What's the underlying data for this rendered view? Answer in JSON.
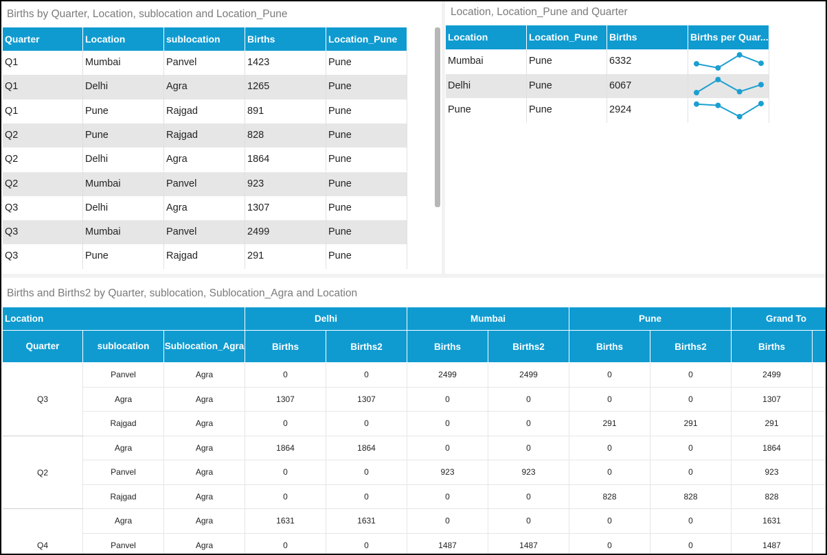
{
  "top_left": {
    "title": "Births by Quarter, Location, sublocation and Location_Pune",
    "headers": [
      "Quarter",
      "Location",
      "sublocation",
      "Births",
      "Location_Pune"
    ],
    "rows": [
      [
        "Q1",
        "Mumbai",
        "Panvel",
        "1423",
        "Pune"
      ],
      [
        "Q1",
        "Delhi",
        "Agra",
        "1265",
        "Pune"
      ],
      [
        "Q1",
        "Pune",
        "Rajgad",
        "891",
        "Pune"
      ],
      [
        "Q2",
        "Pune",
        "Rajgad",
        "828",
        "Pune"
      ],
      [
        "Q2",
        "Delhi",
        "Agra",
        "1864",
        "Pune"
      ],
      [
        "Q2",
        "Mumbai",
        "Panvel",
        "923",
        "Pune"
      ],
      [
        "Q3",
        "Delhi",
        "Agra",
        "1307",
        "Pune"
      ],
      [
        "Q3",
        "Mumbai",
        "Panvel",
        "2499",
        "Pune"
      ],
      [
        "Q3",
        "Pune",
        "Rajgad",
        "291",
        "Pune"
      ]
    ]
  },
  "top_right": {
    "title": "Location, Location_Pune and Quarter",
    "headers": [
      "Location",
      "Location_Pune",
      "Births",
      "Births per Quar..."
    ],
    "rows": [
      {
        "location": "Mumbai",
        "location_pune": "Pune",
        "births": "6332",
        "spark": [
          1423,
          923,
          2499,
          1487
        ]
      },
      {
        "location": "Delhi",
        "location_pune": "Pune",
        "births": "6067",
        "spark": [
          1265,
          1864,
          1307,
          1631
        ]
      },
      {
        "location": "Pune",
        "location_pune": "Pune",
        "births": "2924",
        "spark": [
          891,
          828,
          291,
          914
        ]
      }
    ],
    "spark_color": "#1a9fd1"
  },
  "bottom": {
    "title": "Births and Births2 by Quarter, sublocation, Sublocation_Agra and Location",
    "location_label": "Location",
    "groups": [
      "Delhi",
      "Mumbai",
      "Pune",
      "Grand To"
    ],
    "row_headers": [
      "Quarter",
      "sublocation",
      "Sublocation_Agra"
    ],
    "measures": [
      "Births",
      "Births2",
      "Births",
      "Births2",
      "Births",
      "Births2",
      "Births"
    ],
    "rows": [
      {
        "quarter": "Q3",
        "sub": "Panvel",
        "agra": "Agra",
        "vals": [
          "0",
          "0",
          "2499",
          "2499",
          "0",
          "0",
          "2499"
        ]
      },
      {
        "quarter": "",
        "sub": "Agra",
        "agra": "Agra",
        "vals": [
          "1307",
          "1307",
          "0",
          "0",
          "0",
          "0",
          "1307"
        ]
      },
      {
        "quarter": "",
        "sub": "Rajgad",
        "agra": "Agra",
        "vals": [
          "0",
          "0",
          "0",
          "0",
          "291",
          "291",
          "291"
        ]
      },
      {
        "quarter": "Q2",
        "sub": "Agra",
        "agra": "Agra",
        "vals": [
          "1864",
          "1864",
          "0",
          "0",
          "0",
          "0",
          "1864"
        ]
      },
      {
        "quarter": "",
        "sub": "Panvel",
        "agra": "Agra",
        "vals": [
          "0",
          "0",
          "923",
          "923",
          "0",
          "0",
          "923"
        ]
      },
      {
        "quarter": "",
        "sub": "Rajgad",
        "agra": "Agra",
        "vals": [
          "0",
          "0",
          "0",
          "0",
          "828",
          "828",
          "828"
        ]
      },
      {
        "quarter": "Q4",
        "sub": "Agra",
        "agra": "Agra",
        "vals": [
          "1631",
          "1631",
          "0",
          "0",
          "0",
          "0",
          "1631"
        ]
      },
      {
        "quarter": "",
        "sub": "Panvel",
        "agra": "Agra",
        "vals": [
          "0",
          "0",
          "1487",
          "1487",
          "0",
          "0",
          "1487"
        ]
      }
    ]
  }
}
